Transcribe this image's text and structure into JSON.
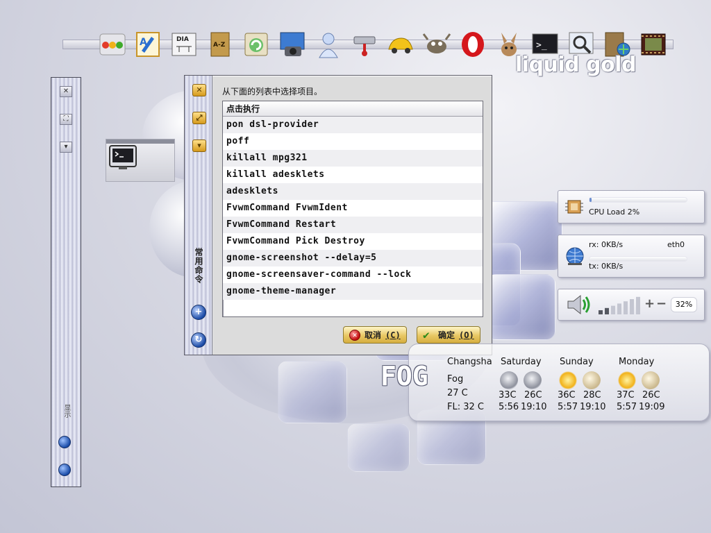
{
  "dock": {
    "brand": "liquid gold",
    "icons": [
      "traffic-light-icon",
      "text-editor-icon",
      "dia-icon",
      "dictionary-icon",
      "image-viewer-icon",
      "photo-camera-icon",
      "user-icon",
      "network-tools-icon",
      "car-icon",
      "gimp-icon",
      "opera-icon",
      "mule-icon",
      "terminal-icon",
      "image-search-icon",
      "file-manager-icon",
      "movie-player-icon"
    ],
    "labels": {
      "dia": "DIA",
      "dictionary": "A-Z",
      "terminal": ">_"
    }
  },
  "left_panel": {
    "close_glyph": "✕",
    "maximize_glyph": "⛶",
    "minimize_glyph": "▾",
    "vertical_text": "显示"
  },
  "dialog": {
    "prompt": "从下面的列表中选择项目。",
    "side_vertical_text": "常用命令",
    "side_buttons": [
      "✕",
      "⤢",
      "▾"
    ],
    "list_header": "点击执行",
    "items": [
      "pon dsl-provider",
      "poff",
      "killall mpg321",
      "killall adesklets",
      "adesklets",
      "FvwmCommand FvwmIdent",
      "FvwmCommand Restart",
      "FvwmCommand Pick Destroy",
      "gnome-screenshot --delay=5",
      "gnome-screensaver-command --lock",
      "gnome-theme-manager"
    ],
    "cancel_label": "取消",
    "cancel_key": "(C)",
    "ok_label": "确定",
    "ok_key": "(O)"
  },
  "monitors": {
    "cpu": {
      "label": "CPU Load 2%",
      "load_fraction": 0.02
    },
    "net": {
      "rx": "rx: 0KB/s",
      "tx": "tx: 0KB/s",
      "iface": "eth0"
    },
    "volume": {
      "plus": "+",
      "minus": "−",
      "percent": "32%",
      "level_fraction": 0.32
    }
  },
  "weather": {
    "banner": "FOG",
    "city": "Changsha",
    "condition": "Fog",
    "temp": "27 C",
    "feels_like": "FL: 32 C",
    "days": [
      {
        "name": "Saturday",
        "high": "33C",
        "low": "26C",
        "sunrise": "5:56",
        "sunset": "19:10",
        "icon_day": "storm-icon",
        "icon_night": "storm-icon"
      },
      {
        "name": "Sunday",
        "high": "36C",
        "low": "28C",
        "sunrise": "5:57",
        "sunset": "19:10",
        "icon_day": "sun-icon",
        "icon_night": "moon-icon"
      },
      {
        "name": "Monday",
        "high": "37C",
        "low": "26C",
        "sunrise": "5:57",
        "sunset": "19:09",
        "icon_day": "partly-cloudy-icon",
        "icon_night": "moon-icon"
      }
    ]
  },
  "colors": {
    "accent_gold": "#e8c763",
    "cancel_red": "#c10d0d",
    "ok_green": "#2c8a1a"
  }
}
